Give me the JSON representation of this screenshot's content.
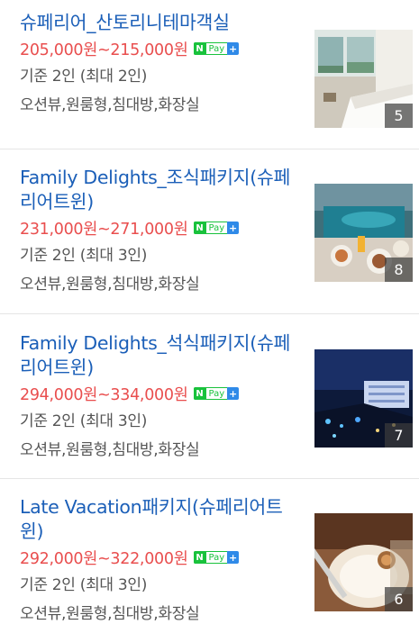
{
  "rooms": [
    {
      "title": "슈페리어_산토리니테마객실",
      "price": "205,000원~215,000원",
      "capacity": "기준 2인 (최대 2인)",
      "features": "오션뷰,원룸형,침대방,화장실",
      "photo_count": "5"
    },
    {
      "title": "Family Delights_조식패키지(슈페리어트윈)",
      "price": "231,000원~271,000원",
      "capacity": "기준 2인 (최대 3인)",
      "features": "오션뷰,원룸형,침대방,화장실",
      "photo_count": "8"
    },
    {
      "title": "Family Delights_석식패키지(슈페리어트윈)",
      "price": "294,000원~334,000원",
      "capacity": "기준 2인 (최대 3인)",
      "features": "오션뷰,원룸형,침대방,화장실",
      "photo_count": "7"
    },
    {
      "title": "Late Vacation패키지(슈페리어트윈)",
      "price": "292,000원~322,000원",
      "capacity": "기준 2인 (최대 3인)",
      "features": "오션뷰,원룸형,침대방,화장실",
      "photo_count": "6"
    }
  ],
  "npay": {
    "n": "N",
    "pay": "Pay",
    "plus": "+"
  },
  "colors": {
    "title": "#1b5fb8",
    "price": "#e94e4e",
    "npay_green": "#19c23c",
    "npay_blue": "#2f8ae8"
  }
}
